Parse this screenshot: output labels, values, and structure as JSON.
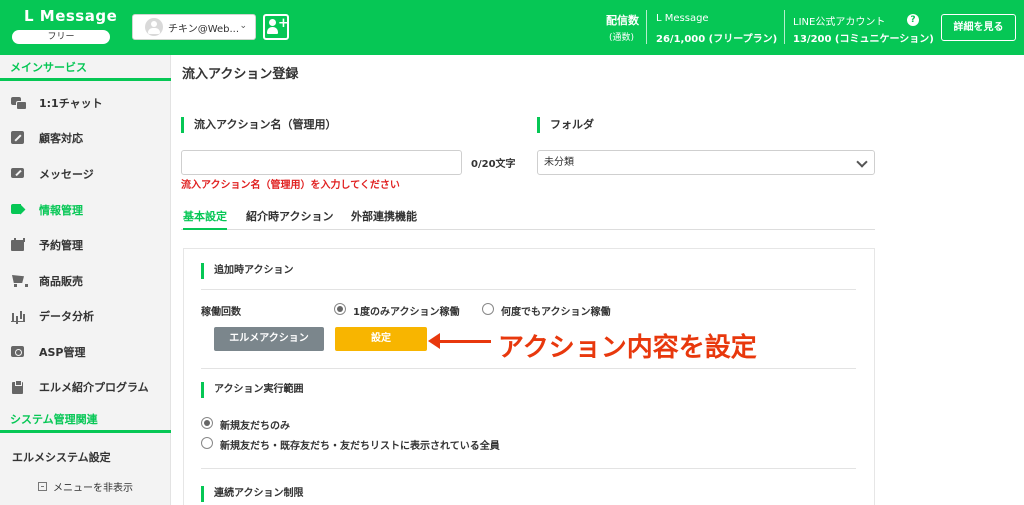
{
  "header": {
    "app_name": "L Message",
    "plan_badge": "フリー",
    "account_name": "チキン@Web...",
    "stats": {
      "delivery_label": "配信数",
      "delivery_sub": "(通数)",
      "lmessage_label": "L Message",
      "lmessage_value": "26/1,000 (フリープラン)",
      "line_label": "LINE公式アカウント",
      "line_value": "13/200 (コミュニケーション)"
    },
    "help_glyph": "?",
    "detail_button": "詳細を見る"
  },
  "sidebar": {
    "main_section": "メインサービス",
    "items": [
      {
        "label": "1:1チャット",
        "icon": "chat-icon"
      },
      {
        "label": "顧客対応",
        "icon": "edit-icon"
      },
      {
        "label": "メッセージ",
        "icon": "message-icon"
      },
      {
        "label": "情報管理",
        "icon": "tag-icon"
      },
      {
        "label": "予約管理",
        "icon": "calendar-icon"
      },
      {
        "label": "商品販売",
        "icon": "cart-icon"
      },
      {
        "label": "データ分析",
        "icon": "chart-icon"
      },
      {
        "label": "ASP管理",
        "icon": "asp-icon"
      },
      {
        "label": "エルメ紹介プログラム",
        "icon": "clipboard-icon"
      }
    ],
    "system_section": "システム管理関連",
    "system_settings": "エルメシステム設定",
    "hide_menu": "メニューを非表示"
  },
  "main": {
    "page_title": "流入アクション登録",
    "name_label": "流入アクション名（管理用）",
    "name_value": "",
    "counter": "0/20文字",
    "name_error": "流入アクション名（管理用）を入力してください",
    "folder_label": "フォルダ",
    "folder_value": "未分類",
    "tabs": [
      "基本設定",
      "紹介時アクション",
      "外部連携機能"
    ],
    "section_add_action": "追加時アクション",
    "run_count_label": "稼働回数",
    "run_once": "1度のみアクション稼働",
    "run_any": "何度でもアクション稼働",
    "lme_action_button": "エルメアクション",
    "set_button": "設定",
    "annotation": "アクション内容を設定",
    "section_scope": "アクション実行範囲",
    "scope_new_only": "新規友だちのみ",
    "scope_all": "新規友だち・既存友だち・友だちリストに表示されている全員",
    "section_continuous": "連続アクション制限"
  },
  "colors": {
    "brand_green": "#06c755",
    "error_red": "#e02020",
    "orange": "#f8b500",
    "annotation_red": "#e8380d"
  }
}
